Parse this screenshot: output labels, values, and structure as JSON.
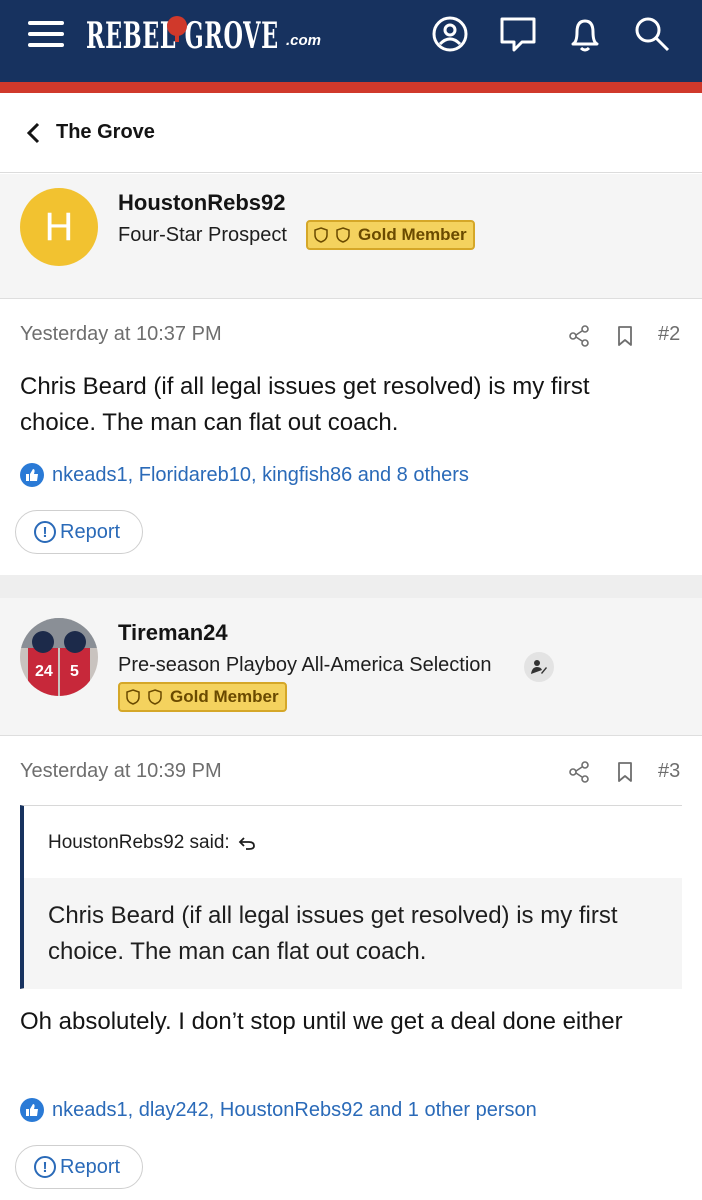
{
  "header": {
    "logo_text": "REBEL GROVE",
    "logo_suffix": ".com",
    "icons": [
      "menu-icon",
      "account-icon",
      "messages-icon",
      "alerts-icon",
      "search-icon"
    ]
  },
  "breadcrumb": {
    "label": "The Grove"
  },
  "colors": {
    "header_bg": "#17325f",
    "accent_red": "#d0392b",
    "link_blue": "#2a6ab8",
    "gold_badge": "#f4d25e"
  },
  "posts": [
    {
      "username": "HoustonRebs92",
      "avatar_letter": "H",
      "user_title": "Four-Star Prospect",
      "badge": "Gold Member",
      "date": "Yesterday at 10:37 PM",
      "post_number": "#2",
      "body": "Chris Beard (if all legal issues get resolved) is my first choice. The man can flat out coach.",
      "likes": "nkeads1, Floridareb10, kingfish86 and 8 others",
      "report_label": "Report"
    },
    {
      "username": "Tireman24",
      "user_title": "Pre-season Playboy All-America Selection",
      "badge": "Gold Member",
      "date": "Yesterday at 10:39 PM",
      "post_number": "#3",
      "quote": {
        "author": "HoustonRebs92 said:",
        "text": "Chris Beard (if all legal issues get resolved) is my first choice. The man can flat out coach."
      },
      "body": "Oh absolutely. I don’t stop until we get a deal done either",
      "likes": "nkeads1, dlay242, HoustonRebs92 and 1 other person",
      "report_label": "Report"
    }
  ]
}
